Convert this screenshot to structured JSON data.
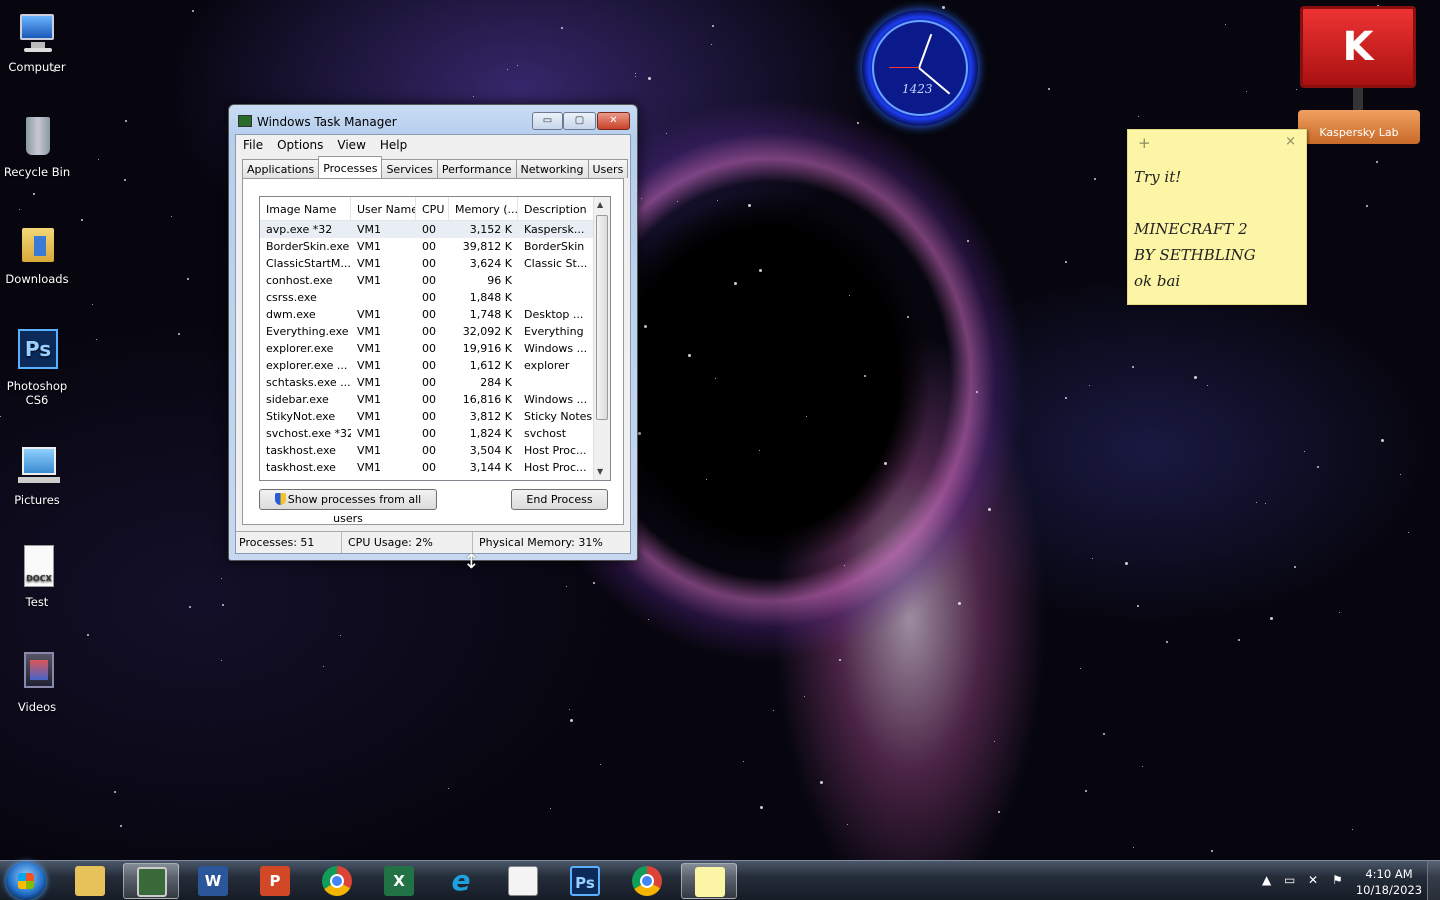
{
  "desktop": {
    "icons": [
      {
        "label": "Computer"
      },
      {
        "label": "Recycle Bin"
      },
      {
        "label": "Downloads"
      },
      {
        "label": "Photoshop CS6"
      },
      {
        "label": "Pictures"
      },
      {
        "label": "Test"
      },
      {
        "label": "Videos"
      }
    ],
    "doc_badge": "DOCX",
    "ps_badge": "Ps"
  },
  "clock_gadget": {
    "digits": "1423"
  },
  "kaspersky_gadget": {
    "label": "Kaspersky Lab",
    "logo": "K"
  },
  "sticky_note": {
    "plus": "+",
    "close": "×",
    "lines": [
      "Try it!",
      "",
      "MINECRAFT 2",
      "BY SETHBLING",
      "ok bai"
    ]
  },
  "task_manager": {
    "title": "Windows Task Manager",
    "buttons": {
      "minimize": "▭",
      "maximize": "▢",
      "close": "✕"
    },
    "menu": [
      "File",
      "Options",
      "View",
      "Help"
    ],
    "tabs": [
      "Applications",
      "Processes",
      "Services",
      "Performance",
      "Networking",
      "Users"
    ],
    "active_tab": "Processes",
    "columns": [
      "Image Name",
      "User Name",
      "CPU",
      "Memory (...",
      "Description"
    ],
    "rows": [
      [
        "avp.exe *32",
        "VM1",
        "00",
        "3,152 K",
        "Kaspersk..."
      ],
      [
        "BorderSkin.exe",
        "VM1",
        "00",
        "39,812 K",
        "BorderSkin"
      ],
      [
        "ClassicStartM...",
        "VM1",
        "00",
        "3,624 K",
        "Classic St..."
      ],
      [
        "conhost.exe",
        "VM1",
        "00",
        "96 K",
        ""
      ],
      [
        "csrss.exe",
        "",
        "00",
        "1,848 K",
        ""
      ],
      [
        "dwm.exe",
        "VM1",
        "00",
        "1,748 K",
        "Desktop ..."
      ],
      [
        "Everything.exe",
        "VM1",
        "00",
        "32,092 K",
        "Everything"
      ],
      [
        "explorer.exe",
        "VM1",
        "00",
        "19,916 K",
        "Windows ..."
      ],
      [
        "explorer.exe ...",
        "VM1",
        "00",
        "1,612 K",
        "explorer"
      ],
      [
        "schtasks.exe ...",
        "VM1",
        "00",
        "284 K",
        ""
      ],
      [
        "sidebar.exe",
        "VM1",
        "00",
        "16,816 K",
        "Windows ..."
      ],
      [
        "StikyNot.exe",
        "VM1",
        "00",
        "3,812 K",
        "Sticky Notes"
      ],
      [
        "svchost.exe *32",
        "VM1",
        "00",
        "1,824 K",
        "svchost"
      ],
      [
        "taskhost.exe",
        "VM1",
        "00",
        "3,504 K",
        "Host Proc..."
      ],
      [
        "taskhost.exe",
        "VM1",
        "00",
        "3,144 K",
        "Host Proc..."
      ]
    ],
    "show_all_label": "Show processes from all users",
    "end_process_label": "End Process",
    "status": {
      "processes": "Processes: 51",
      "cpu": "CPU Usage: 2%",
      "memory": "Physical Memory: 31%"
    }
  },
  "taskbar": {
    "apps": [
      {
        "name": "file-explorer",
        "glyph": ""
      },
      {
        "name": "task-manager",
        "glyph": ""
      },
      {
        "name": "word",
        "glyph": "W"
      },
      {
        "name": "powerpoint",
        "glyph": "P"
      },
      {
        "name": "chrome",
        "glyph": ""
      },
      {
        "name": "excel",
        "glyph": "X"
      },
      {
        "name": "internet-explorer",
        "glyph": "e"
      },
      {
        "name": "notepad",
        "glyph": ""
      },
      {
        "name": "photoshop",
        "glyph": "Ps"
      },
      {
        "name": "chrome-2",
        "glyph": ""
      },
      {
        "name": "sticky-notes",
        "glyph": ""
      }
    ],
    "time": "4:10 AM",
    "date": "10/18/2023"
  },
  "colors": {
    "word": "#2b579a",
    "powerpoint": "#d24726",
    "excel": "#217346",
    "ie": "#1ea0e0",
    "photoshop": "#0b2a5a",
    "explorer": "#e7c15a",
    "sticky": "#fdf5a6"
  }
}
